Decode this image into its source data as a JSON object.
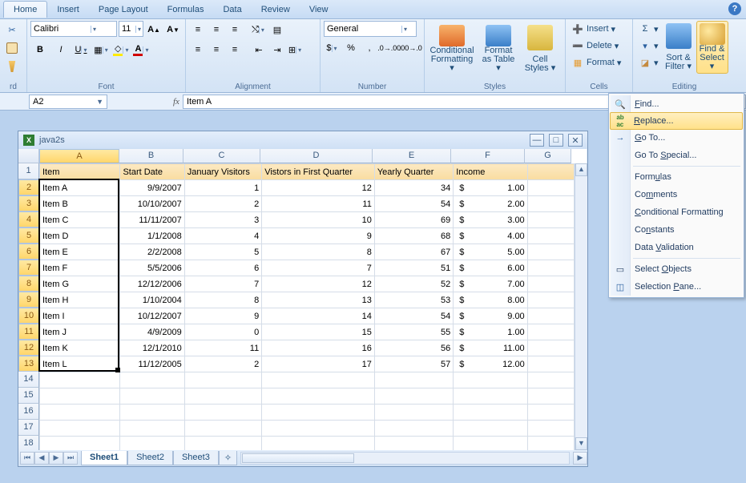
{
  "tabs": [
    "Home",
    "Insert",
    "Page Layout",
    "Formulas",
    "Data",
    "Review",
    "View"
  ],
  "activeTab": 0,
  "font": {
    "name": "Calibri",
    "size": "11"
  },
  "groups": {
    "clipboard": "rd",
    "font": "Font",
    "alignment": "Alignment",
    "number": "Number",
    "styles": "Styles",
    "cells": "Cells",
    "editing": "Editing",
    "numberFormat": "General"
  },
  "styleBtns": {
    "cond": "Conditional Formatting",
    "tbl": "Format as Table",
    "sty": "Cell Styles"
  },
  "cellBtns": {
    "ins": "Insert",
    "del": "Delete",
    "fmt": "Format"
  },
  "editBtns": {
    "sort": "Sort & Filter",
    "find": "Find & Select"
  },
  "nameBox": "A2",
  "formula": "Item A",
  "wbk": {
    "title": "java2s"
  },
  "cols": [
    "A",
    "B",
    "C",
    "D",
    "E",
    "F",
    "G"
  ],
  "headers": [
    "Item",
    "Start Date",
    "January Visitors",
    "Vistors in First Quarter",
    "Yearly Quarter",
    "Income"
  ],
  "rows": [
    {
      "a": "Item A",
      "b": "9/9/2007",
      "c": "1",
      "d": "12",
      "e": "34",
      "f": "1.00"
    },
    {
      "a": "Item B",
      "b": "10/10/2007",
      "c": "2",
      "d": "11",
      "e": "54",
      "f": "2.00"
    },
    {
      "a": "Item C",
      "b": "11/11/2007",
      "c": "3",
      "d": "10",
      "e": "69",
      "f": "3.00"
    },
    {
      "a": "Item D",
      "b": "1/1/2008",
      "c": "4",
      "d": "9",
      "e": "68",
      "f": "4.00"
    },
    {
      "a": "Item E",
      "b": "2/2/2008",
      "c": "5",
      "d": "8",
      "e": "67",
      "f": "5.00"
    },
    {
      "a": "Item F",
      "b": "5/5/2006",
      "c": "6",
      "d": "7",
      "e": "51",
      "f": "6.00"
    },
    {
      "a": "Item G",
      "b": "12/12/2006",
      "c": "7",
      "d": "12",
      "e": "52",
      "f": "7.00"
    },
    {
      "a": "Item H",
      "b": "1/10/2004",
      "c": "8",
      "d": "13",
      "e": "53",
      "f": "8.00"
    },
    {
      "a": "Item I",
      "b": "10/12/2007",
      "c": "9",
      "d": "14",
      "e": "54",
      "f": "9.00"
    },
    {
      "a": "Item J",
      "b": "4/9/2009",
      "c": "0",
      "d": "15",
      "e": "55",
      "f": "1.00"
    },
    {
      "a": "Item K",
      "b": "12/1/2010",
      "c": "11",
      "d": "16",
      "e": "56",
      "f": "11.00"
    },
    {
      "a": "Item L",
      "b": "11/12/2005",
      "c": "2",
      "d": "17",
      "e": "57",
      "f": "12.00"
    }
  ],
  "dollar": "$",
  "sheets": [
    "Sheet1",
    "Sheet2",
    "Sheet3"
  ],
  "menu": {
    "find": "Find...",
    "replace": "Replace...",
    "goto": "Go To...",
    "gotosp": "Go To Special...",
    "formulas": "Formulas",
    "comments": "Comments",
    "condfmt": "Conditional Formatting",
    "constants": "Constants",
    "datav": "Data Validation",
    "selobj": "Select Objects",
    "selpane": "Selection Pane..."
  }
}
